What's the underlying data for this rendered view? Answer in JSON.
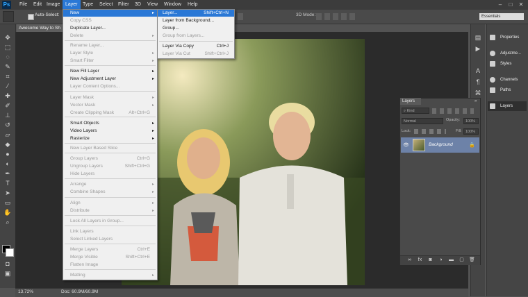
{
  "app": {
    "logo": "Ps"
  },
  "menubar": [
    "File",
    "Edit",
    "Image",
    "Layer",
    "Type",
    "Select",
    "Filter",
    "3D",
    "View",
    "Window",
    "Help"
  ],
  "optbar": {
    "auto_select": "Auto-Select:",
    "mode_label": "3D Mode:",
    "workspace": "Essentials"
  },
  "document": {
    "tab_title": "Awesome Way to Sh",
    "zoom": "13.72%",
    "doc_info": "Doc: 60.9M/60.9M"
  },
  "layer_menu": {
    "items": [
      {
        "label": "New",
        "shortcut": "",
        "sub": true,
        "disabled": false,
        "highlight": true
      },
      {
        "label": "Copy CSS",
        "shortcut": "",
        "sub": false,
        "disabled": true
      },
      {
        "label": "Duplicate Layer...",
        "shortcut": "",
        "sub": false,
        "disabled": false
      },
      {
        "label": "Delete",
        "shortcut": "",
        "sub": true,
        "disabled": true
      },
      {
        "label": "Rename Layer...",
        "shortcut": "",
        "sub": false,
        "disabled": true
      },
      {
        "label": "Layer Style",
        "shortcut": "",
        "sub": true,
        "disabled": true
      },
      {
        "label": "Smart Filter",
        "shortcut": "",
        "sub": true,
        "disabled": true
      },
      {
        "label": "New Fill Layer",
        "shortcut": "",
        "sub": true,
        "disabled": false
      },
      {
        "label": "New Adjustment Layer",
        "shortcut": "",
        "sub": true,
        "disabled": false
      },
      {
        "label": "Layer Content Options...",
        "shortcut": "",
        "sub": false,
        "disabled": true
      },
      {
        "label": "Layer Mask",
        "shortcut": "",
        "sub": true,
        "disabled": true
      },
      {
        "label": "Vector Mask",
        "shortcut": "",
        "sub": true,
        "disabled": true
      },
      {
        "label": "Create Clipping Mask",
        "shortcut": "Alt+Ctrl+G",
        "sub": false,
        "disabled": true
      },
      {
        "label": "Smart Objects",
        "shortcut": "",
        "sub": true,
        "disabled": false
      },
      {
        "label": "Video Layers",
        "shortcut": "",
        "sub": true,
        "disabled": false
      },
      {
        "label": "Rasterize",
        "shortcut": "",
        "sub": true,
        "disabled": false
      },
      {
        "label": "New Layer Based Slice",
        "shortcut": "",
        "sub": false,
        "disabled": true
      },
      {
        "label": "Group Layers",
        "shortcut": "Ctrl+G",
        "sub": false,
        "disabled": true
      },
      {
        "label": "Ungroup Layers",
        "shortcut": "Shift+Ctrl+G",
        "sub": false,
        "disabled": true
      },
      {
        "label": "Hide Layers",
        "shortcut": "",
        "sub": false,
        "disabled": true
      },
      {
        "label": "Arrange",
        "shortcut": "",
        "sub": true,
        "disabled": true
      },
      {
        "label": "Combine Shapes",
        "shortcut": "",
        "sub": true,
        "disabled": true
      },
      {
        "label": "Align",
        "shortcut": "",
        "sub": true,
        "disabled": true
      },
      {
        "label": "Distribute",
        "shortcut": "",
        "sub": true,
        "disabled": true
      },
      {
        "label": "Lock All Layers in Group...",
        "shortcut": "",
        "sub": false,
        "disabled": true
      },
      {
        "label": "Link Layers",
        "shortcut": "",
        "sub": false,
        "disabled": true
      },
      {
        "label": "Select Linked Layers",
        "shortcut": "",
        "sub": false,
        "disabled": true
      },
      {
        "label": "Merge Layers",
        "shortcut": "Ctrl+E",
        "sub": false,
        "disabled": true
      },
      {
        "label": "Merge Visible",
        "shortcut": "Shift+Ctrl+E",
        "sub": false,
        "disabled": true
      },
      {
        "label": "Flatten Image",
        "shortcut": "",
        "sub": false,
        "disabled": true
      },
      {
        "label": "Matting",
        "shortcut": "",
        "sub": true,
        "disabled": true
      }
    ]
  },
  "new_submenu": {
    "items": [
      {
        "label": "Layer...",
        "shortcut": "Shift+Ctrl+N",
        "disabled": false,
        "highlight": true
      },
      {
        "label": "Layer from Background...",
        "shortcut": "",
        "disabled": false
      },
      {
        "label": "Group...",
        "shortcut": "",
        "disabled": false
      },
      {
        "label": "Group from Layers...",
        "shortcut": "",
        "disabled": true
      },
      {
        "label": "Layer Via Copy",
        "shortcut": "Ctrl+J",
        "disabled": false
      },
      {
        "label": "Layer Via Cut",
        "shortcut": "Shift+Ctrl+J",
        "disabled": true
      }
    ]
  },
  "right_panels": [
    "Properties",
    "Adjustme...",
    "Styles",
    "Channels",
    "Paths",
    "Layers"
  ],
  "layers_panel": {
    "tab": "Layers",
    "kind": "Kind",
    "blend_mode": "Normal",
    "opacity_label": "Opacity:",
    "opacity": "100%",
    "lock_label": "Lock:",
    "fill_label": "Fill:",
    "fill": "100%",
    "layer_name": "Background"
  }
}
